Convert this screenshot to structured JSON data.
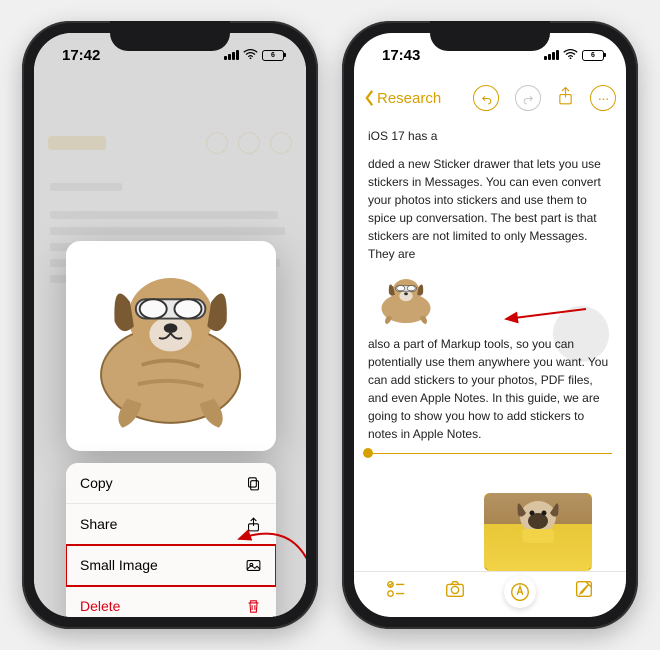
{
  "left": {
    "time": "17:42",
    "battery": "6",
    "menu": {
      "copy": "Copy",
      "share": "Share",
      "small_image": "Small Image",
      "delete": "Delete"
    }
  },
  "right": {
    "time": "17:43",
    "battery": "6",
    "back_label": "Research",
    "note": {
      "line1": "iOS 17 has a",
      "para1": "dded a new Sticker drawer that lets you use stickers in Messages. You can even convert your photos into stickers and use them to spice up conversation. The best part is that stickers are not limited to only Messages. They are",
      "para2": " also a part of Markup tools, so you can potentially use them anywhere you want. You can add stickers to your photos, PDF files, and even Apple Notes. In this guide, we are going to show you how to add stickers to notes in Apple Notes."
    }
  },
  "colors": {
    "accent": "#d6a000",
    "destructive": "#d70015",
    "annotation": "#cc0000"
  }
}
